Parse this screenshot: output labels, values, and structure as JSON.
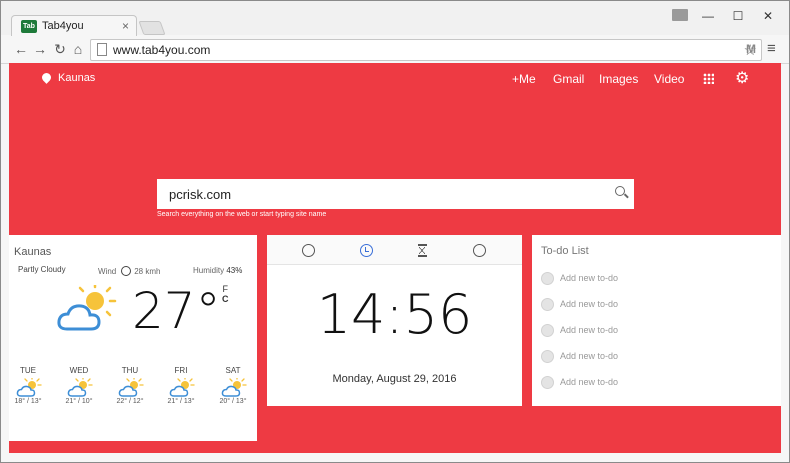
{
  "browser": {
    "tab_title": "Tab4you",
    "favicon_text": "Tab",
    "url": "www.tab4you.com"
  },
  "header": {
    "location": "Kaunas",
    "nav": [
      "+Me",
      "Gmail",
      "Images",
      "Video"
    ]
  },
  "search": {
    "value": "pcrisk.com",
    "hint": "Search everything on the web or start typing site name"
  },
  "weather": {
    "city": "Kaunas",
    "condition": "Partly Cloudy",
    "wind_label": "Wind",
    "wind_value": "28 kmh",
    "humidity_label": "Humidity",
    "humidity_value": "43%",
    "temperature": "27°",
    "unit_top": "F",
    "unit_bottom": "C",
    "forecast": [
      {
        "day": "TUE",
        "temps": "18° / 13°"
      },
      {
        "day": "WED",
        "temps": "21° / 10°"
      },
      {
        "day": "THU",
        "temps": "22° / 12°"
      },
      {
        "day": "FRI",
        "temps": "21° / 13°"
      },
      {
        "day": "SAT",
        "temps": "20° / 13°"
      }
    ]
  },
  "clock": {
    "time": "14:56",
    "date": "Monday, August 29, 2016"
  },
  "todo": {
    "title": "To-do List",
    "items": [
      "Add new to-do",
      "Add new to-do",
      "Add new to-do",
      "Add new to-do",
      "Add new to-do"
    ]
  },
  "colors": {
    "page_accent": "#ee3a43",
    "clock_tab_active": "#3a6fd8"
  }
}
